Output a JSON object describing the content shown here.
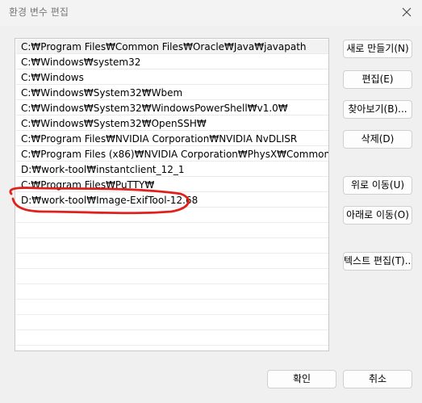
{
  "window": {
    "title": "환경 변수 편집"
  },
  "icons": {
    "close": "close-icon"
  },
  "path_list": [
    "C:₩Program Files₩Common Files₩Oracle₩Java₩javapath",
    "C:₩Windows₩system32",
    "C:₩Windows",
    "C:₩Windows₩System32₩Wbem",
    "C:₩Windows₩System32₩WindowsPowerShell₩v1.0₩",
    "C:₩Windows₩System32₩OpenSSH₩",
    "C:₩Program Files₩NVIDIA Corporation₩NVIDIA NvDLISR",
    "C:₩Program Files (x86)₩NVIDIA Corporation₩PhysX₩Common",
    "D:₩work-tool₩instantclient_12_1",
    "C:₩Program Files₩PuTTY₩",
    "D:₩work-tool₩Image-ExifTool-12.68"
  ],
  "buttons": {
    "new": "새로 만들기(N)",
    "edit": "편집(E)",
    "browse": "찾아보기(B)...",
    "delete": "삭제(D)",
    "move_up": "위로 이동(U)",
    "move_down": "아래로 이동(O)",
    "edit_text": "텍스트 편집(T)...",
    "ok": "확인",
    "cancel": "취소"
  },
  "colors": {
    "annotation": "#e0201b",
    "window_bg": "#f0f0f0",
    "list_bg": "#ffffff",
    "selected_row": "#f2f2f2"
  }
}
